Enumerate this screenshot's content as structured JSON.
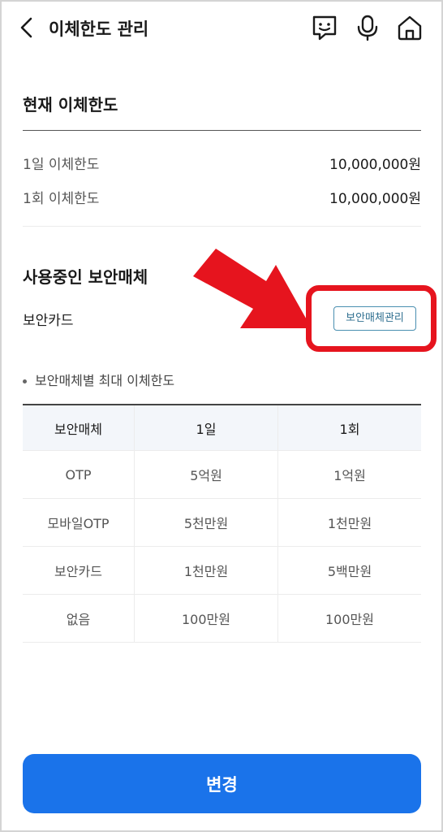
{
  "header": {
    "title": "이체한도 관리",
    "back_icon": "chevron-left-icon",
    "chat_icon": "chat-face-icon",
    "mic_icon": "microphone-icon",
    "home_icon": "home-icon"
  },
  "current_limit": {
    "title": "현재 이체한도",
    "rows": [
      {
        "label": "1일 이체한도",
        "value": "10,000,000원"
      },
      {
        "label": "1회 이체한도",
        "value": "10,000,000원"
      }
    ]
  },
  "security_media": {
    "title": "사용중인 보안매체",
    "value": "보안카드",
    "manage_button": "보안매체관리",
    "highlight_color": "#e6141e"
  },
  "limit_table": {
    "caption": "보안매체별 최대 이체한도",
    "headers": [
      "보안매체",
      "1일",
      "1회"
    ],
    "rows": [
      [
        "OTP",
        "5억원",
        "1억원"
      ],
      [
        "모바일OTP",
        "5천만원",
        "1천만원"
      ],
      [
        "보안카드",
        "1천만원",
        "5백만원"
      ],
      [
        "없음",
        "100만원",
        "100만원"
      ]
    ]
  },
  "footer": {
    "change_button": "변경",
    "button_color": "#1a73ea"
  }
}
